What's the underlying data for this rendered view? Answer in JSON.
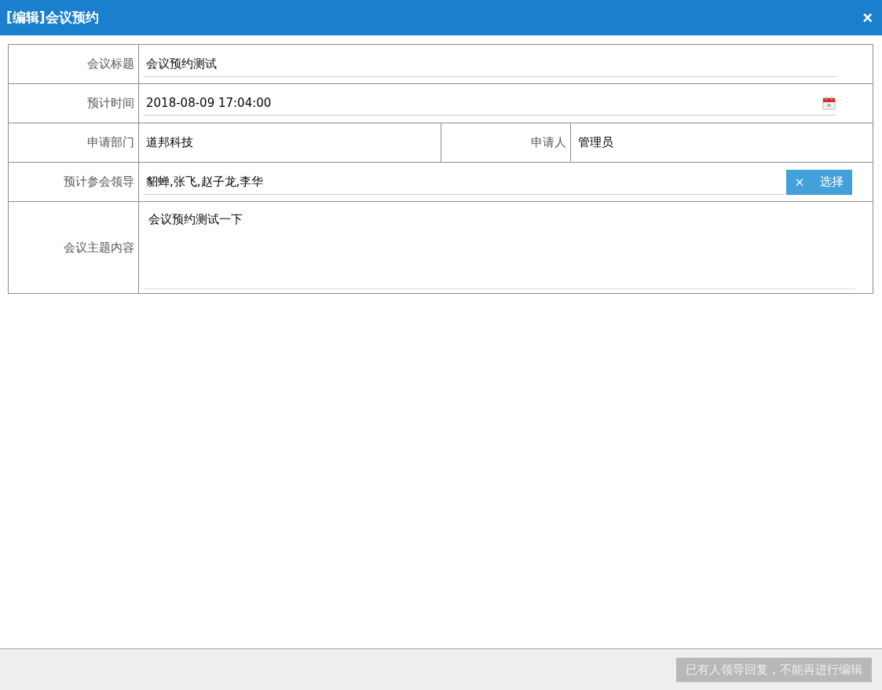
{
  "window": {
    "title": "[编辑]会议预约",
    "close": "×"
  },
  "form": {
    "title": {
      "label": "会议标题",
      "value": "会议预约测试"
    },
    "time": {
      "label": "预计时间",
      "value": "2018-08-09 17:04:00"
    },
    "department": {
      "label": "申请部门",
      "value": "道邦科技"
    },
    "applicant": {
      "label": "申请人",
      "value": "管理员"
    },
    "leaders": {
      "label": "预计参会领导",
      "value": "貂蝉,张飞,赵子龙,李华",
      "clear": "×",
      "select": "选择"
    },
    "content": {
      "label": "会议主题内容",
      "value": "会议预约测试一下"
    }
  },
  "footer": {
    "button": {
      "label": "已有人领导回复，不能再进行编辑",
      "disabled": true
    }
  }
}
